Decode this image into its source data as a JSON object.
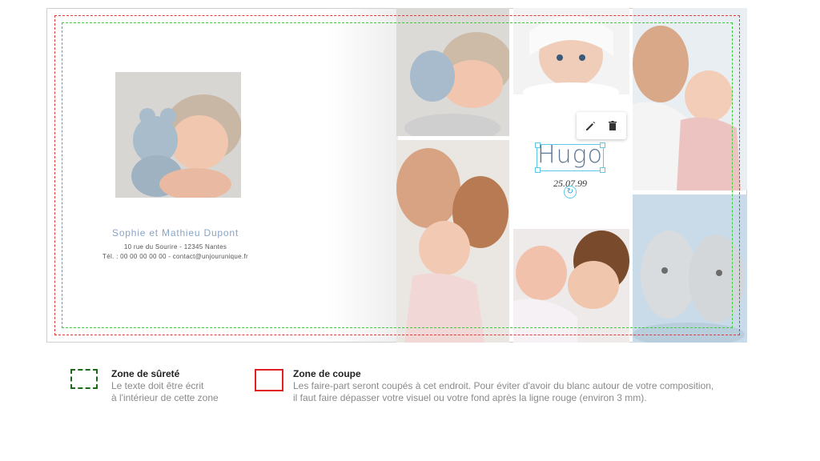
{
  "card": {
    "family_name": "Sophie et Mathieu Dupont",
    "address_line": "10 rue du Sourire - 12345 Nantes",
    "contact_line": "Tél. : 00 00 00 00 00 - contact@unjourunique.fr",
    "baby_name": "Hugo",
    "birth_date": "25.07.99"
  },
  "toolbar": {
    "edit_icon": "pencil-icon",
    "delete_icon": "trash-icon"
  },
  "legend": {
    "safe": {
      "title": "Zone de sûreté",
      "line1": "Le texte doit être écrit",
      "line2": "à l'intérieur de cette zone"
    },
    "cut": {
      "title": "Zone de coupe",
      "line1": "Les faire-part seront coupés à cet endroit. Pour éviter d'avoir du blanc autour de votre composition,",
      "line2": "il faut faire dépasser votre visuel ou votre fond après la ligne rouge (environ 3 mm)."
    }
  },
  "colors": {
    "safe_zone": "#3ccc3c",
    "cut_zone": "#e23a3a",
    "selection": "#5cc8e6",
    "accent_text": "#8aa4c6"
  }
}
